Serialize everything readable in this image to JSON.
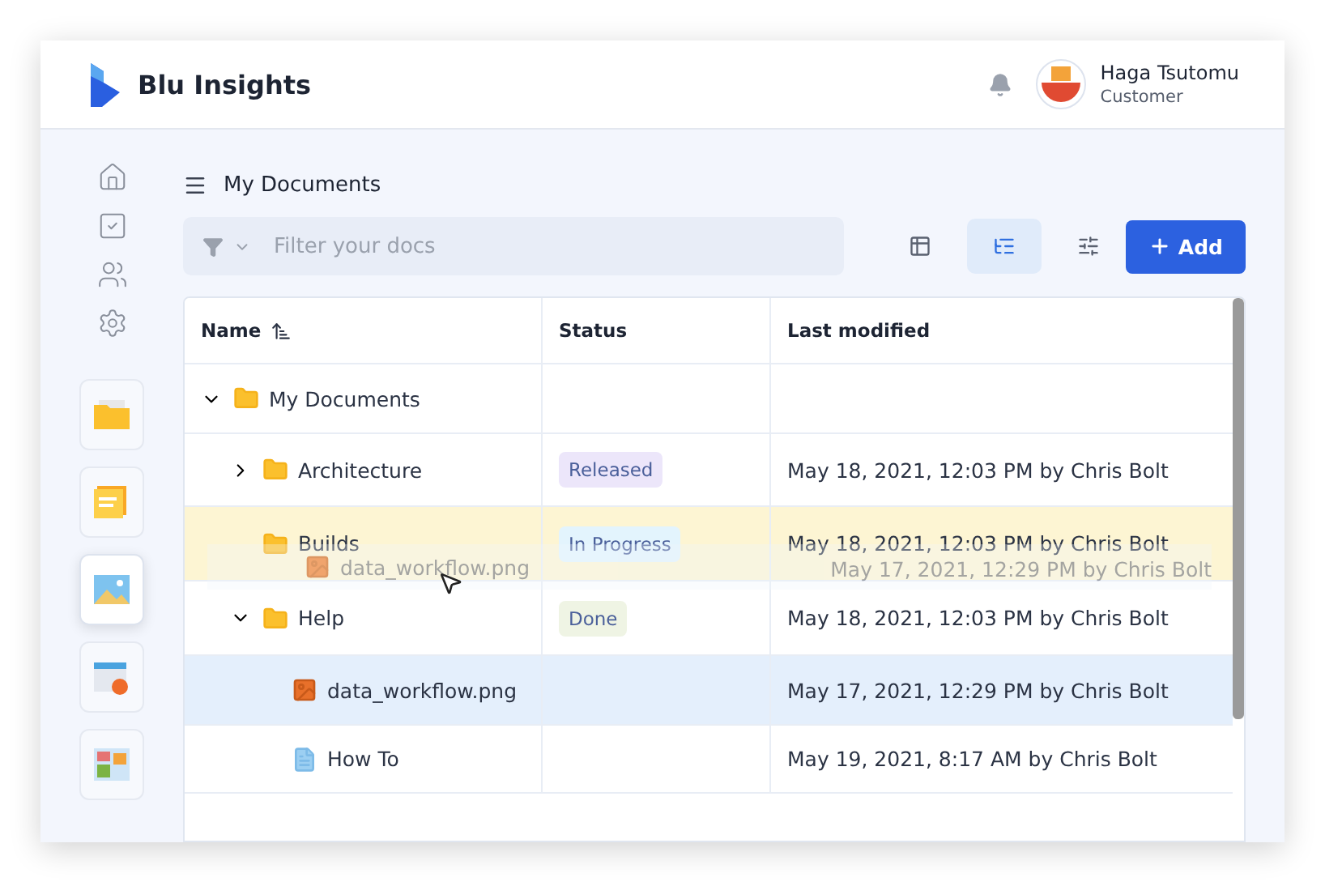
{
  "app": {
    "name": "Blu Insights"
  },
  "user": {
    "name": "Haga Tsutomu",
    "role": "Customer"
  },
  "nav_icons": [
    {
      "kind": "home"
    },
    {
      "kind": "tasks"
    },
    {
      "kind": "users"
    },
    {
      "kind": "settings"
    }
  ],
  "app_tiles": [
    {
      "kind": "folder",
      "selected": false
    },
    {
      "kind": "notes",
      "selected": false
    },
    {
      "kind": "picture",
      "selected": true
    },
    {
      "kind": "calendar",
      "selected": false
    },
    {
      "kind": "map",
      "selected": false
    }
  ],
  "page_title": "My Documents",
  "filter": {
    "placeholder": "Filter your docs"
  },
  "view_buttons": [
    {
      "kind": "table",
      "selected": false
    },
    {
      "kind": "tree",
      "selected": true
    },
    {
      "kind": "sliders",
      "selected": false
    }
  ],
  "add_button": "Add",
  "table": {
    "columns": [
      "Name",
      "Status",
      "Last modified"
    ],
    "rows": [
      {
        "name": "My Documents",
        "kind": "folder",
        "expanded": true,
        "selected": false,
        "drop_target": false,
        "children": [
          {
            "name": "Architecture",
            "kind": "folder",
            "expanded": false,
            "selected": false,
            "drop_target": false,
            "status": {
              "label": "Released",
              "color": "#ece6fa"
            },
            "modified": "May 18, 2021, 12:03 PM by Chris Bolt"
          },
          {
            "name": "Builds",
            "kind": "folder",
            "selected": false,
            "drop_target": true,
            "status": {
              "label": "In Progress",
              "color": "#e3f4fd"
            },
            "modified": "May 18, 2021, 12:03 PM by Chris Bolt"
          },
          {
            "name": "Help",
            "kind": "folder",
            "expanded": true,
            "selected": false,
            "drop_target": false,
            "status": {
              "label": "Done",
              "color": "#eff4e4"
            },
            "modified": "May 18, 2021, 12:03 PM by Chris Bolt",
            "children": [
              {
                "name": "data_workflow.png",
                "kind": "image",
                "selected": true,
                "drop_target": false,
                "modified": "May 17, 2021, 12:29 PM by Chris Bolt"
              },
              {
                "name": "How To",
                "kind": "doc",
                "selected": false,
                "drop_target": false,
                "modified": "May 19, 2021, 8:17 AM by Chris Bolt"
              }
            ]
          }
        ]
      }
    ]
  },
  "drag_preview": {
    "name": "data_workflow.png",
    "modified": "May 17, 2021, 12:29 PM by Chris Bolt"
  }
}
